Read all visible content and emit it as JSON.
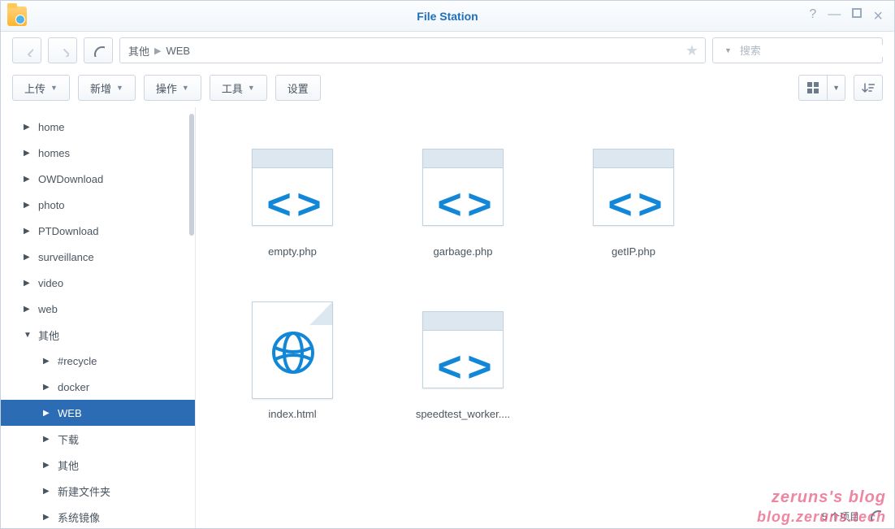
{
  "title": "File Station",
  "breadcrumb": [
    "其他",
    "WEB"
  ],
  "search": {
    "placeholder": "搜索"
  },
  "toolbar": {
    "upload": "上传",
    "create": "新增",
    "action": "操作",
    "tools": "工具",
    "settings": "设置"
  },
  "tree": [
    {
      "label": "home",
      "level": 0,
      "expanded": false,
      "selected": false
    },
    {
      "label": "homes",
      "level": 0,
      "expanded": false,
      "selected": false
    },
    {
      "label": "OWDownload",
      "level": 0,
      "expanded": false,
      "selected": false
    },
    {
      "label": "photo",
      "level": 0,
      "expanded": false,
      "selected": false
    },
    {
      "label": "PTDownload",
      "level": 0,
      "expanded": false,
      "selected": false
    },
    {
      "label": "surveillance",
      "level": 0,
      "expanded": false,
      "selected": false
    },
    {
      "label": "video",
      "level": 0,
      "expanded": false,
      "selected": false
    },
    {
      "label": "web",
      "level": 0,
      "expanded": false,
      "selected": false
    },
    {
      "label": "其他",
      "level": 0,
      "expanded": true,
      "selected": false
    },
    {
      "label": "#recycle",
      "level": 1,
      "expanded": false,
      "selected": false
    },
    {
      "label": "docker",
      "level": 1,
      "expanded": false,
      "selected": false
    },
    {
      "label": "WEB",
      "level": 1,
      "expanded": false,
      "selected": true
    },
    {
      "label": "下载",
      "level": 1,
      "expanded": false,
      "selected": false
    },
    {
      "label": "其他",
      "level": 1,
      "expanded": false,
      "selected": false
    },
    {
      "label": "新建文件夹",
      "level": 1,
      "expanded": false,
      "selected": false
    },
    {
      "label": "系统镜像",
      "level": 1,
      "expanded": false,
      "selected": false
    }
  ],
  "files": [
    {
      "name": "empty.php",
      "type": "code"
    },
    {
      "name": "garbage.php",
      "type": "code"
    },
    {
      "name": "getIP.php",
      "type": "code"
    },
    {
      "name": "index.html",
      "type": "html"
    },
    {
      "name": "speedtest_worker....",
      "type": "code"
    }
  ],
  "status": {
    "count": "5 个项目"
  },
  "watermark": {
    "line1": "zeruns's blog",
    "line2": "blog.zeruns.tech"
  }
}
